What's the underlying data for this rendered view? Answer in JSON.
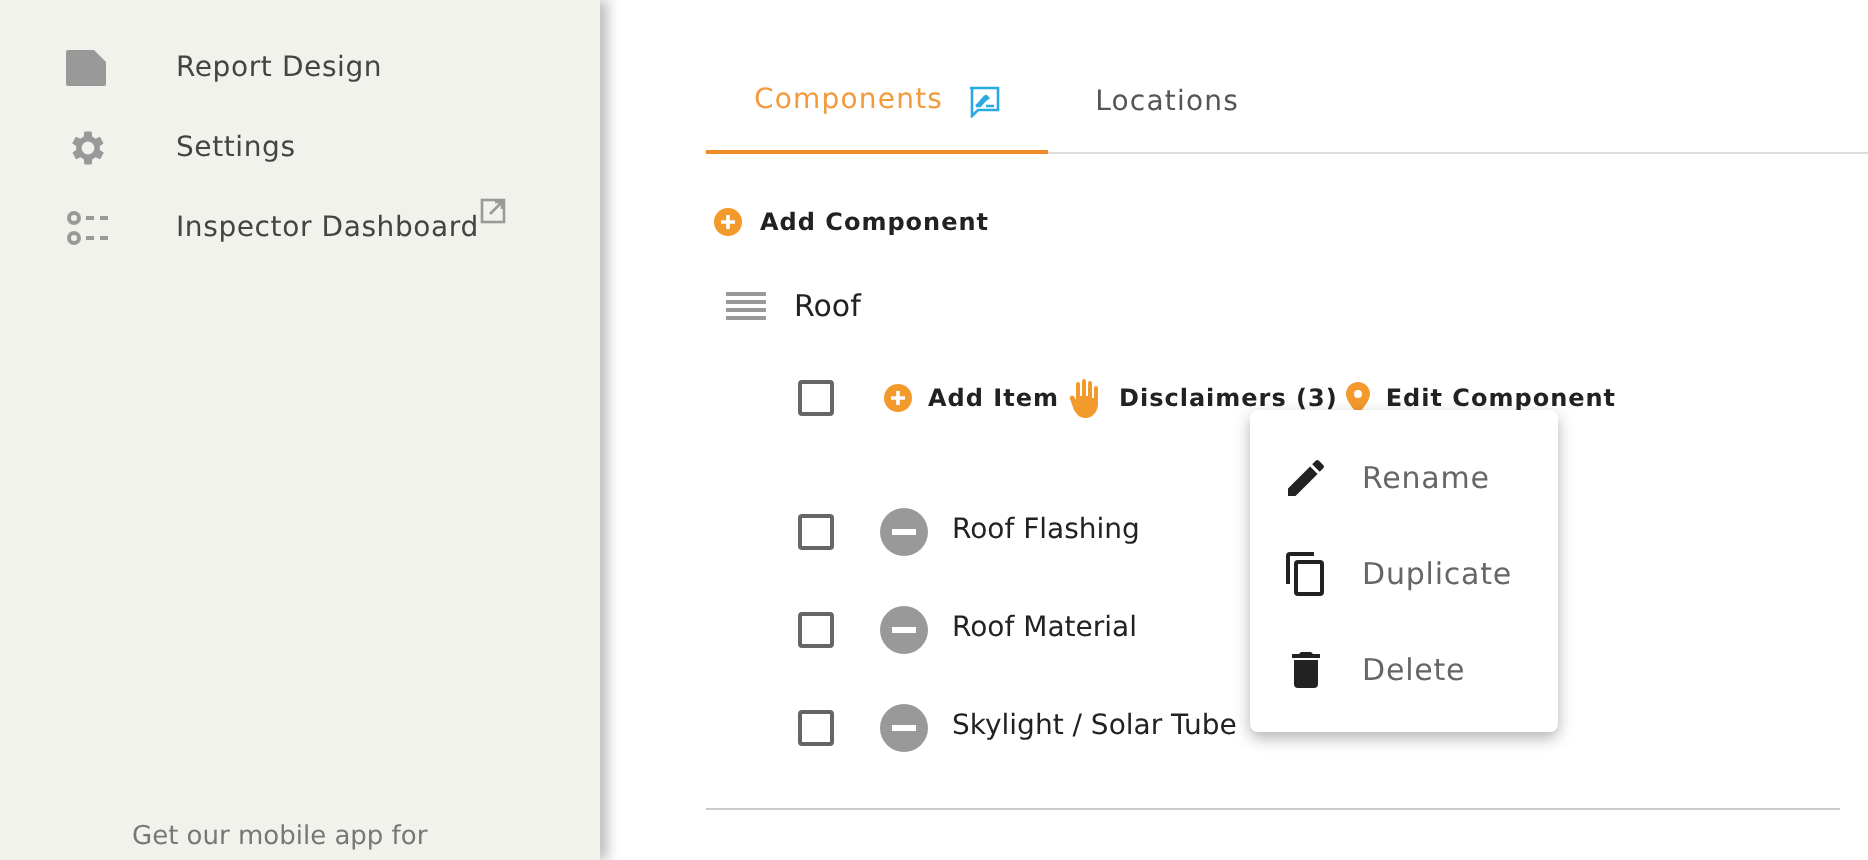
{
  "sidebar": {
    "items": [
      {
        "label": "Report Design",
        "kind": "document",
        "external": false
      },
      {
        "label": "Settings",
        "kind": "gear",
        "external": false
      },
      {
        "label": "Inspector Dashboard",
        "kind": "list",
        "external": true
      }
    ],
    "footer": "Get our mobile app for"
  },
  "tabs": [
    {
      "label": "Components",
      "selected": true,
      "badge": true
    },
    {
      "label": "Locations",
      "selected": false,
      "badge": false
    }
  ],
  "add_component": "Add Component",
  "component": {
    "name": "Roof",
    "checked": false,
    "actions": [
      {
        "kind": "add",
        "label": "Add Item"
      },
      {
        "kind": "hand",
        "label": "Disclaimers (3)"
      },
      {
        "kind": "pin",
        "label": "Edit Component"
      }
    ],
    "items": [
      {
        "name": "Roof Flashing",
        "checked": false
      },
      {
        "name": "Roof Material",
        "checked": false
      },
      {
        "name": "Skylight / Solar Tube",
        "checked": false
      }
    ]
  },
  "menu": [
    {
      "kind": "rename",
      "label": "Rename"
    },
    {
      "kind": "duplicate",
      "label": "Duplicate"
    },
    {
      "kind": "delete",
      "label": "Delete"
    }
  ]
}
